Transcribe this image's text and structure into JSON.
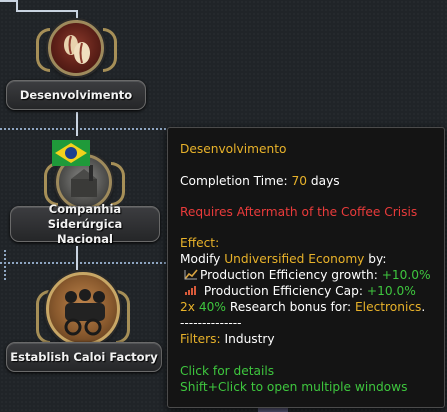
{
  "focuses": [
    {
      "name": "Desenvolvimento",
      "icon": "coffee-bean-icon"
    },
    {
      "name": "Companhia Siderúrgica Nacional",
      "line1": "Companhia Siderúrgica",
      "line2": "Nacional",
      "icon": "brazil-flag-factory-icon"
    },
    {
      "name": "Establish Caloi Factory",
      "icon": "cyclists-icon"
    }
  ],
  "tooltip": {
    "title": "Desenvolvimento",
    "completion_label": "Completion Time:",
    "completion_value": "70",
    "completion_unit": "days",
    "requirement": "Requires Aftermath of the Coffee Crisis",
    "effect_label": "Effect:",
    "modify_prefix": "Modify",
    "modify_target": "Undiversified Economy",
    "modify_suffix": "by:",
    "mod1_label": "Production Efficiency growth:",
    "mod1_value": "+10.0%",
    "mod2_label": "Production Efficiency Cap:",
    "mod2_value": "+10.0%",
    "bonus_count": "2x",
    "bonus_pct": "40%",
    "bonus_text": "Research bonus for:",
    "bonus_target": "Electronics",
    "bonus_end": ".",
    "separator": "--------------",
    "filters_label": "Filters:",
    "filters_value": "Industry",
    "hint1": "Click for details",
    "hint2": "Shift+Click to open multiple windows"
  },
  "colors": {
    "gold": "#e8b22a",
    "green": "#3ec63e",
    "red": "#ea3b3b"
  }
}
